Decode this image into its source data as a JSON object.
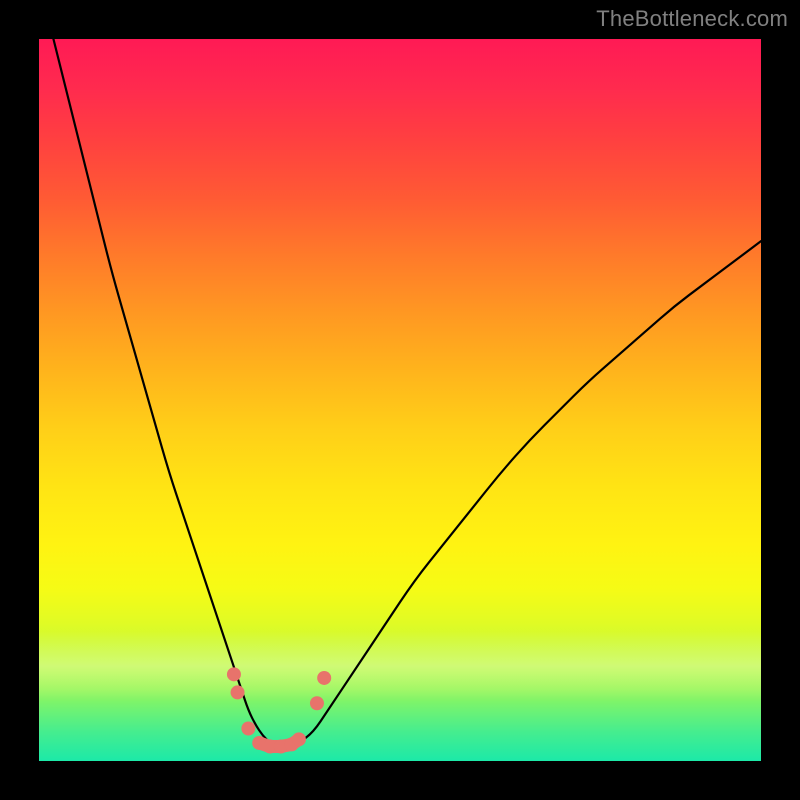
{
  "watermark": "TheBottleneck.com",
  "colors": {
    "background": "#000000",
    "gradient_top": "#ff1a55",
    "gradient_bottom": "#1ce9a8",
    "curve": "#000000",
    "markers": "#e8736b"
  },
  "chart_data": {
    "type": "line",
    "title": "",
    "xlabel": "",
    "ylabel": "",
    "xlim": [
      0,
      100
    ],
    "ylim": [
      0,
      100
    ],
    "x": [
      0,
      2,
      4,
      6,
      8,
      10,
      12,
      14,
      16,
      18,
      20,
      22,
      24,
      26,
      27,
      28,
      29,
      30,
      31,
      32,
      33,
      34,
      35,
      36,
      38,
      40,
      44,
      48,
      52,
      56,
      60,
      64,
      68,
      72,
      76,
      80,
      84,
      88,
      92,
      96,
      100
    ],
    "values": [
      108,
      100,
      92,
      84,
      76,
      68,
      61,
      54,
      47,
      40,
      34,
      28,
      22,
      16,
      13,
      10,
      7,
      5,
      3.5,
      2.5,
      2,
      2,
      2,
      2.5,
      4,
      7,
      13,
      19,
      25,
      30,
      35,
      40,
      44.5,
      48.5,
      52.5,
      56,
      59.5,
      63,
      66,
      69,
      72
    ],
    "series": [
      {
        "name": "bottleneck-curve",
        "description": "V-shaped curve; bottom near x≈33 at y≈2"
      }
    ],
    "markers": [
      {
        "x": 27.0,
        "y": 12.0
      },
      {
        "x": 27.5,
        "y": 9.5
      },
      {
        "x": 29.0,
        "y": 4.5
      },
      {
        "x": 30.5,
        "y": 2.5
      },
      {
        "x": 32.0,
        "y": 2.0
      },
      {
        "x": 33.5,
        "y": 2.0
      },
      {
        "x": 35.0,
        "y": 2.3
      },
      {
        "x": 36.0,
        "y": 3.0
      },
      {
        "x": 38.5,
        "y": 8.0
      },
      {
        "x": 39.5,
        "y": 11.5
      }
    ],
    "grid": false,
    "legend": false
  }
}
